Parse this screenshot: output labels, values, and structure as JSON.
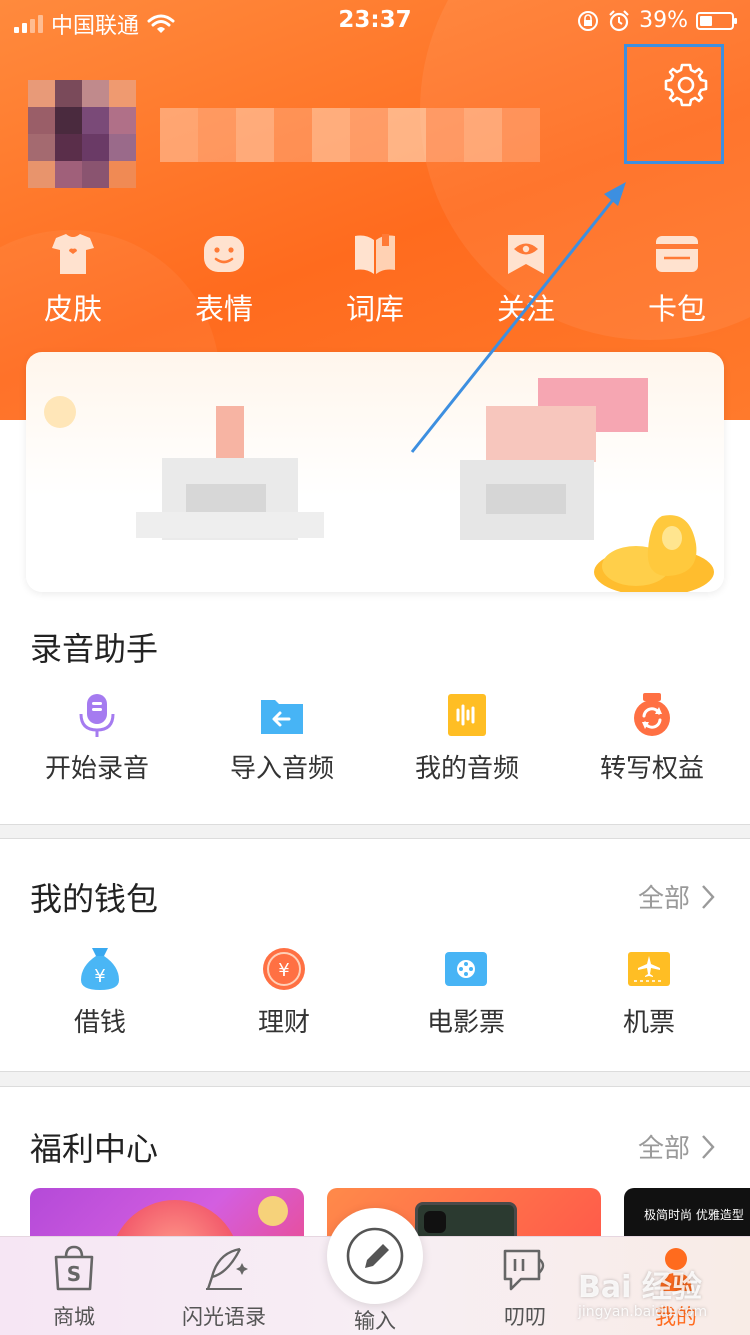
{
  "status_bar": {
    "carrier": "中国联通",
    "time": "23:37",
    "battery_percent": "39%"
  },
  "header": {
    "settings_icon": "gear-icon",
    "quick_links": [
      {
        "label": "皮肤",
        "icon": "tshirt-icon"
      },
      {
        "label": "表情",
        "icon": "smiley-icon"
      },
      {
        "label": "词库",
        "icon": "book-icon"
      },
      {
        "label": "关注",
        "icon": "eye-flag-icon"
      },
      {
        "label": "卡包",
        "icon": "card-wallet-icon"
      }
    ]
  },
  "recording": {
    "title": "录音助手",
    "items": [
      {
        "label": "开始录音",
        "icon": "microphone-icon"
      },
      {
        "label": "导入音频",
        "icon": "import-folder-icon"
      },
      {
        "label": "我的音频",
        "icon": "audio-file-icon"
      },
      {
        "label": "转写权益",
        "icon": "transcribe-refresh-icon"
      }
    ]
  },
  "wallet": {
    "title": "我的钱包",
    "more_label": "全部",
    "items": [
      {
        "label": "借钱",
        "icon": "money-bag-icon"
      },
      {
        "label": "理财",
        "icon": "yuan-coin-icon"
      },
      {
        "label": "电影票",
        "icon": "film-ticket-icon"
      },
      {
        "label": "机票",
        "icon": "plane-ticket-icon"
      }
    ]
  },
  "welfare": {
    "title": "福利中心",
    "more_label": "全部",
    "promo_3_text": "极简时尚 优雅造型"
  },
  "tabbar": {
    "tabs": [
      {
        "label": "商城",
        "icon": "shop-bag-icon"
      },
      {
        "label": "闪光语录",
        "icon": "feather-pen-icon"
      },
      {
        "label": "输入",
        "icon": "pencil-icon"
      },
      {
        "label": "叨叨",
        "icon": "chat-bubble-icon"
      },
      {
        "label": "我的",
        "icon": "profile-icon"
      }
    ],
    "active_index": 4
  },
  "watermark": {
    "text": "Bai 经验",
    "sub": "jingyan.baidu.com"
  },
  "colors": {
    "brand_orange": "#ff6b1e",
    "annotation_blue": "#3d8fe0",
    "tab_active": "#ff6b1e"
  }
}
